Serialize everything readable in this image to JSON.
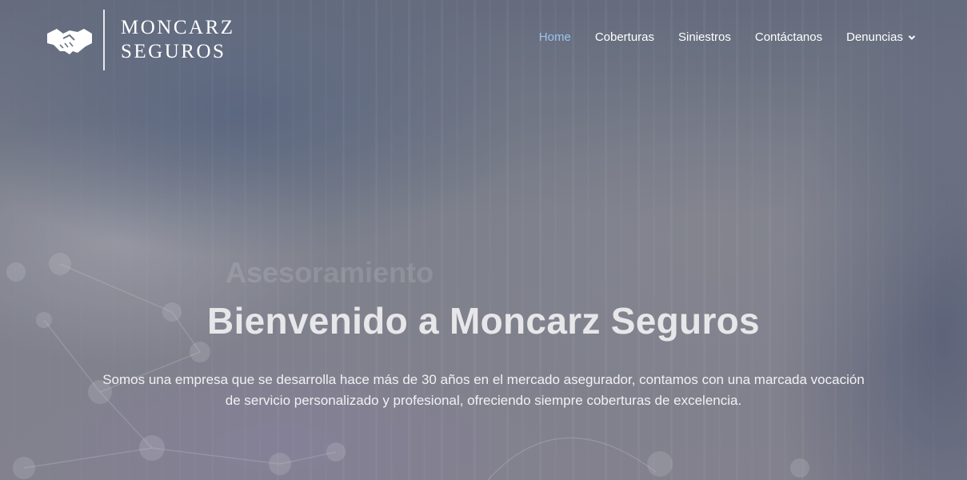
{
  "brand": {
    "name_line1": "MONCARZ",
    "name_line2": "SEGUROS",
    "icon": "handshake-icon"
  },
  "nav": {
    "items": [
      {
        "label": "Home",
        "active": true
      },
      {
        "label": "Coberturas",
        "active": false
      },
      {
        "label": "Siniestros",
        "active": false
      },
      {
        "label": "Contáctanos",
        "active": false
      },
      {
        "label": "Denuncias",
        "active": false,
        "has_dropdown": true,
        "icon": "chevron-down-icon"
      }
    ]
  },
  "hero": {
    "ghost_text": "Asesoramiento",
    "title": "Bienvenido a Moncarz Seguros",
    "subtitle_line1": "Somos una empresa que se desarrolla hace más de 30 años en el mercado asegurador, contamos con una marcada vocación",
    "subtitle_line2": "de servicio personalizado y profesional, ofreciendo siempre coberturas de excelencia."
  },
  "colors": {
    "nav_active": "#9ec3ee",
    "nav_text": "#ffffff",
    "title_text": "#e7e7ea"
  }
}
